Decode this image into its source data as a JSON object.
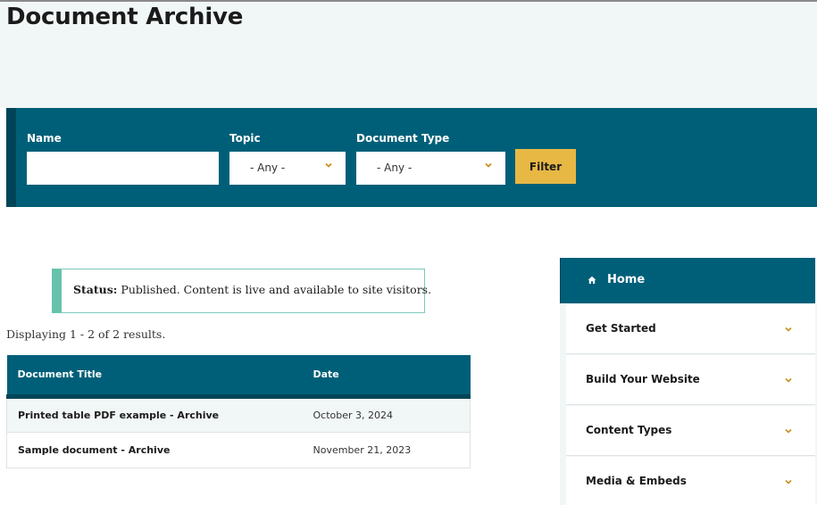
{
  "page": {
    "title": "Document Archive"
  },
  "filters": {
    "name_label": "Name",
    "name_value": "",
    "topic_label": "Topic",
    "topic_selected": "- Any -",
    "doc_type_label": "Document Type",
    "doc_type_selected": "- Any -",
    "filter_button": "Filter"
  },
  "status": {
    "label": "Status:",
    "message": "Published. Content is live and available to site visitors."
  },
  "results": {
    "summary": "Displaying 1 - 2 of 2 results."
  },
  "table": {
    "headers": {
      "title": "Document Title",
      "date": "Date"
    },
    "rows": [
      {
        "title": "Printed table PDF example - Archive",
        "date": "October 3, 2024"
      },
      {
        "title": "Sample document - Archive",
        "date": "November 21, 2023"
      }
    ]
  },
  "sidenav": {
    "home": "Home",
    "items": [
      {
        "label": "Get Started"
      },
      {
        "label": "Build Your Website"
      },
      {
        "label": "Content Types"
      },
      {
        "label": "Media & Embeds"
      }
    ]
  },
  "icons": {
    "select": "chevron-down-icon",
    "nav": "chevron-down-icon",
    "home": "home-icon"
  },
  "colors": {
    "primary": "#005f78",
    "primary_dark": "#004557",
    "accent": "#e8b845",
    "status": "#66c2aa",
    "hero_bg": "#f1f6f6"
  }
}
